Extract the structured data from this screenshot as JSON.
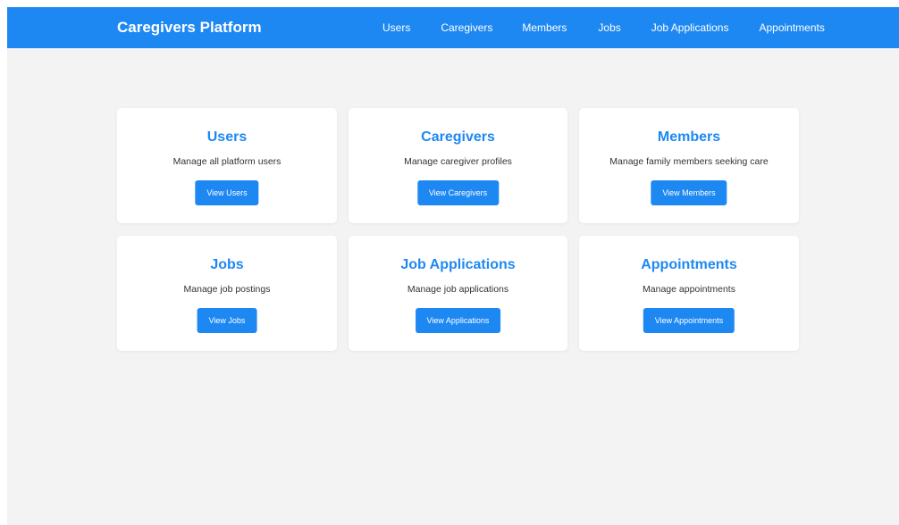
{
  "navbar": {
    "brand": "Caregivers Platform",
    "links": [
      "Users",
      "Caregivers",
      "Members",
      "Jobs",
      "Job Applications",
      "Appointments"
    ]
  },
  "cards": [
    {
      "title": "Users",
      "description": "Manage all platform users",
      "button": "View Users"
    },
    {
      "title": "Caregivers",
      "description": "Manage caregiver profiles",
      "button": "View Caregivers"
    },
    {
      "title": "Members",
      "description": "Manage family members seeking care",
      "button": "View Members"
    },
    {
      "title": "Jobs",
      "description": "Manage job postings",
      "button": "View Jobs"
    },
    {
      "title": "Job Applications",
      "description": "Manage job applications",
      "button": "View Applications"
    },
    {
      "title": "Appointments",
      "description": "Manage appointments",
      "button": "View Appointments"
    }
  ],
  "colors": {
    "primary": "#1e88f2",
    "background": "#f3f3f3",
    "card": "#ffffff",
    "text": "#333333"
  }
}
